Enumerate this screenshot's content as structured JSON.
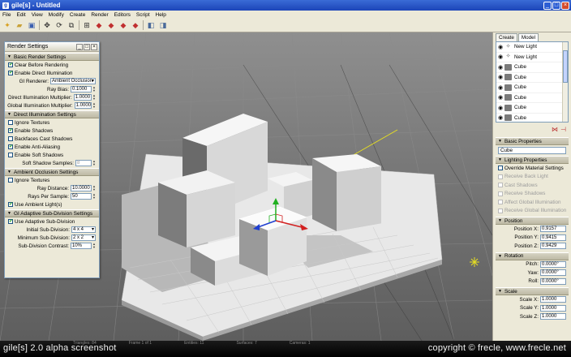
{
  "window": {
    "title": "gile[s] - Untitled",
    "app_icon": "g"
  },
  "menu": [
    "File",
    "Edit",
    "View",
    "Modify",
    "Create",
    "Render",
    "Editors",
    "Script",
    "Help"
  ],
  "toolbar_icons": [
    "new-file-icon",
    "open-folder-icon",
    "save-icon",
    "move-icon",
    "rotate-icon",
    "scale-icon",
    "grid-icon",
    "paint-icon",
    "paint-icon",
    "paint-icon",
    "paint-icon",
    "view-icon",
    "view-icon"
  ],
  "render_settings": {
    "title": "Render Settings",
    "basic": {
      "header": "Basic Render Settings",
      "clear_before": "Clear Before Rendering",
      "enable_direct": "Enable Direct Illumination",
      "gi_renderer_label": "GI Renderer:",
      "gi_renderer_value": "Ambient Occlusion",
      "ray_bias_label": "Ray Bias:",
      "ray_bias_value": "0.1000",
      "direct_mult_label": "Direct Illumination Multiplier:",
      "direct_mult_value": "1.0000",
      "global_mult_label": "Global Illumination Multiplier:",
      "global_mult_value": "1.0000"
    },
    "direct": {
      "header": "Direct Illumination Settings",
      "ignore_textures": "Ignore Textures",
      "enable_shadows": "Enable Shadows",
      "backface_shadows": "Backfaces Cast Shadows",
      "enable_aa": "Enable Anti-Aliasing",
      "enable_soft": "Enable Soft Shadows",
      "soft_samples_label": "Soft Shadow Samples:",
      "soft_samples_value": "8"
    },
    "ao": {
      "header": "Ambient Occlusion Settings",
      "ignore_textures": "Ignore Textures",
      "ray_distance_label": "Ray Distance:",
      "ray_distance_value": "10.0000",
      "rays_per_sample_label": "Rays Per Sample:",
      "rays_per_sample_value": "50",
      "use_ambient": "Use Ambient Light(s)"
    },
    "adaptive": {
      "header": "GI Adaptive Sub-Division Settings",
      "use_adaptive": "Use Adaptive Sub-Division",
      "initial_label": "Initial Sub-Division:",
      "initial_value": "4 x 4",
      "minimum_label": "Minimum Sub-Division:",
      "minimum_value": "2 x 2",
      "contrast_label": "Sub-Division Contrast:",
      "contrast_value": "10%"
    }
  },
  "right_panel": {
    "tabs": [
      "Create",
      "Model"
    ],
    "outliner": [
      {
        "name": "New Light",
        "kind": "light"
      },
      {
        "name": "New Light",
        "kind": "light"
      },
      {
        "name": "Cube",
        "kind": "mesh"
      },
      {
        "name": "Cube",
        "kind": "mesh"
      },
      {
        "name": "Cube",
        "kind": "mesh"
      },
      {
        "name": "Cube",
        "kind": "mesh"
      },
      {
        "name": "Cube",
        "kind": "mesh"
      },
      {
        "name": "Cube",
        "kind": "mesh"
      }
    ],
    "basic_header": "Basic Properties",
    "name_value": "Cube",
    "lighting_header": "Lighting Properties",
    "override": "Override Material Settings",
    "receive_back": "Receive Back Light",
    "cast_shadows": "Cast Shadows",
    "receive_shadows": "Receive Shadows",
    "affect_gi": "Affect Global Illumination",
    "receive_gi": "Receive Global Illumination",
    "position_header": "Position",
    "pos_x_label": "Position X:",
    "pos_x": "0.9157",
    "pos_y_label": "Position Y:",
    "pos_y": "0.9415",
    "pos_z_label": "Position Z:",
    "pos_z": "0.9429",
    "rotation_header": "Rotation",
    "pitch_label": "Pitch:",
    "pitch": "0.0000°",
    "yaw_label": "Yaw:",
    "yaw": "0.0000°",
    "roll_label": "Roll:",
    "roll": "0.0000°",
    "scale_header": "Scale",
    "scale_x_label": "Scale X:",
    "scale_x": "1.0000",
    "scale_y_label": "Scale Y:",
    "scale_y": "1.0000",
    "scale_z_label": "Scale Z:",
    "scale_z": "1.0000"
  },
  "status": {
    "triangles": "Triangles: 84",
    "frame": "Frame 1 of 1",
    "entities": "Entities: 11",
    "surfaces": "Surfaces: 7",
    "cameras": "Cameras: 1"
  },
  "captions": {
    "left": "gile[s] 2.0 alpha screenshot",
    "right": "copyright © frecle, www.frecle.net"
  },
  "colors": {
    "title_bar": "#2452c8",
    "panel": "#ece9d8",
    "x_axis": "#d22020",
    "y_axis": "#20b020",
    "z_axis": "#2040d0",
    "light_marker": "#e8e020"
  }
}
